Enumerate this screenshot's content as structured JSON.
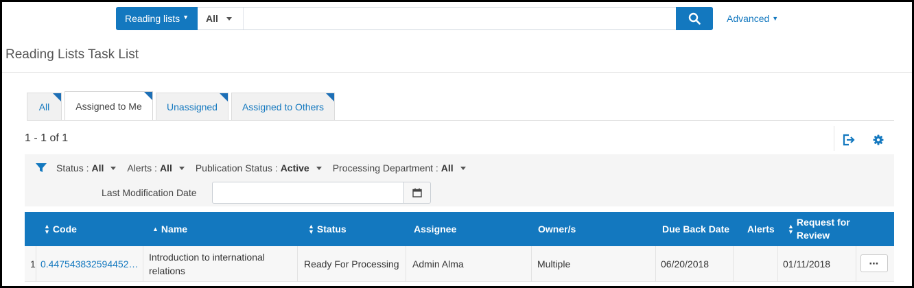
{
  "search": {
    "scope_label": "Reading lists",
    "filter_label": "All",
    "query": "",
    "advanced_label": "Advanced"
  },
  "page": {
    "title": "Reading Lists Task List"
  },
  "tabs": [
    {
      "label": "All",
      "active": false
    },
    {
      "label": "Assigned to Me",
      "active": true
    },
    {
      "label": "Unassigned",
      "active": false
    },
    {
      "label": "Assigned to Others",
      "active": false
    }
  ],
  "results": {
    "count_text": "1 - 1 of 1"
  },
  "filters": {
    "status": {
      "label": "Status :",
      "value": "All"
    },
    "alerts": {
      "label": "Alerts :",
      "value": "All"
    },
    "publication_status": {
      "label": "Publication Status :",
      "value": "Active"
    },
    "processing_department": {
      "label": "Processing Department :",
      "value": "All"
    },
    "last_modification_date": {
      "label": "Last Modification Date",
      "value": ""
    }
  },
  "table": {
    "columns": {
      "code": "Code",
      "name": "Name",
      "status": "Status",
      "assignee": "Assignee",
      "owners": "Owner/s",
      "due_back": "Due Back Date",
      "alerts": "Alerts",
      "request_line1": "Request for",
      "request_line2": "Review"
    },
    "rows": [
      {
        "index": "1",
        "code": "0.447543832594452…",
        "name_line1": "Introduction to international",
        "name_line2": "relations",
        "status": "Ready For Processing",
        "assignee": "Admin Alma",
        "owners": "Multiple",
        "due_back": "06/20/2018",
        "alerts": "",
        "request_for_review": "01/11/2018",
        "actions_label": "⋯"
      }
    ]
  },
  "colors": {
    "primary": "#1378bf",
    "tab_corner": "#1d6fb6"
  }
}
